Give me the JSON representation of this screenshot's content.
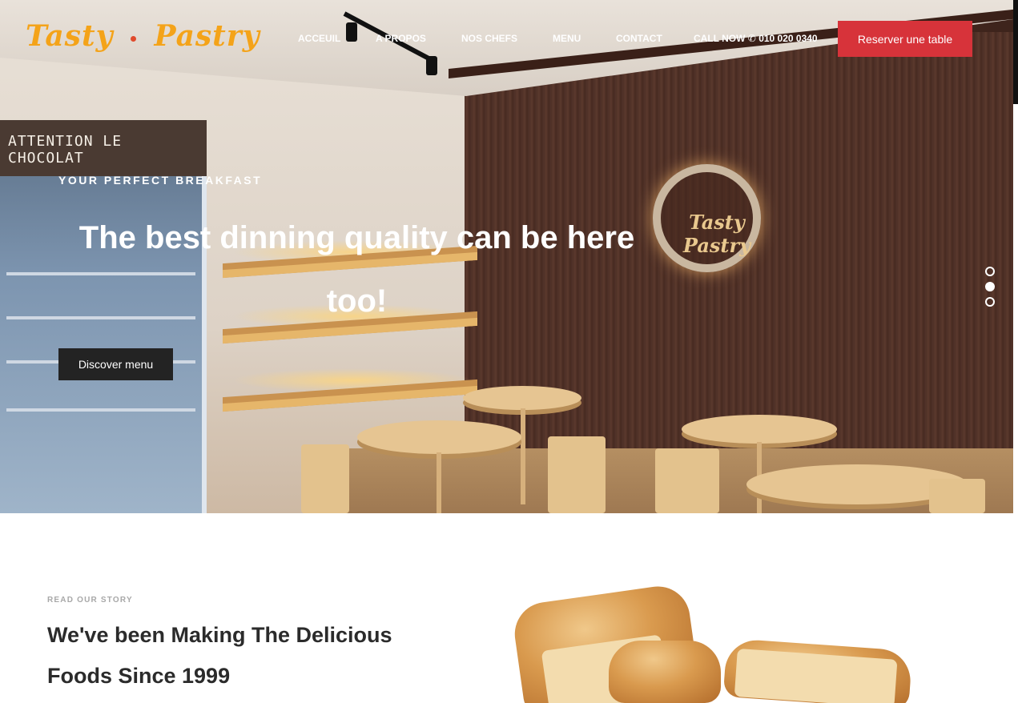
{
  "header": {
    "logo_part1": "Tasty",
    "logo_part2": "Pastry",
    "nav": [
      {
        "label": "ACCEUIL"
      },
      {
        "label": "A PROPOS"
      },
      {
        "label": "NOS CHEFS"
      },
      {
        "label": "MENU"
      },
      {
        "label": "CONTACT"
      }
    ],
    "call_label": "CALL NOW",
    "phone_icon": "phone-icon",
    "phone": "010 020 0340",
    "reserve_label": "Reserver une table"
  },
  "hero": {
    "eyebrow": "YOUR PERFECT BREAKFAST",
    "title_line1": "The best dinning quality can be here",
    "title_line2": "too!",
    "button_label": "Discover menu",
    "slides_total": 3,
    "active_slide": 2,
    "fridge_sign": "ATTENTION LE CHOCOLAT",
    "wall_sign": "Tasty Pastry"
  },
  "story": {
    "eyebrow": "READ OUR STORY",
    "title_line1": "We've been Making The Delicious",
    "title_line2": "Foods Since 1999"
  },
  "colors": {
    "logo": "#f4a319",
    "logo_dot": "#e04a2c",
    "reserve_button": "#d7333a",
    "hero_button": "#232323",
    "heading_text": "#2b2b2b",
    "eyebrow_text": "#a8a8a8"
  }
}
